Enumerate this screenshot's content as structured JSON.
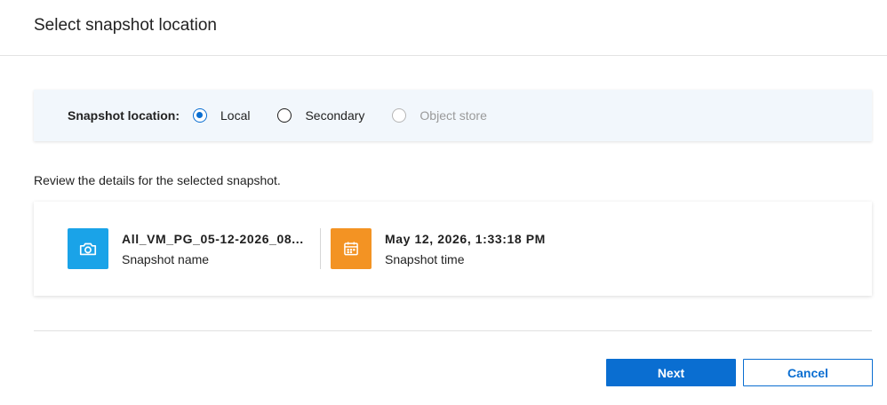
{
  "dialog": {
    "title": "Select snapshot location"
  },
  "location": {
    "label": "Snapshot location:",
    "options": [
      {
        "label": "Local",
        "selected": true,
        "disabled": false
      },
      {
        "label": "Secondary",
        "selected": false,
        "disabled": false
      },
      {
        "label": "Object store",
        "selected": false,
        "disabled": true
      }
    ]
  },
  "review": {
    "text": "Review the details for the selected snapshot."
  },
  "details": {
    "name": {
      "value": "All_VM_PG_05-12-2026_08...",
      "caption": "Snapshot name",
      "icon": "camera-icon",
      "color": "#1aa3e8"
    },
    "time": {
      "value": "May 12, 2026, 1:33:18 PM",
      "caption": "Snapshot time",
      "icon": "calendar-icon",
      "color": "#f39323"
    }
  },
  "footer": {
    "next_label": "Next",
    "cancel_label": "Cancel"
  },
  "colors": {
    "accent": "#0a6ed1",
    "panel_bg": "#f2f7fc"
  }
}
